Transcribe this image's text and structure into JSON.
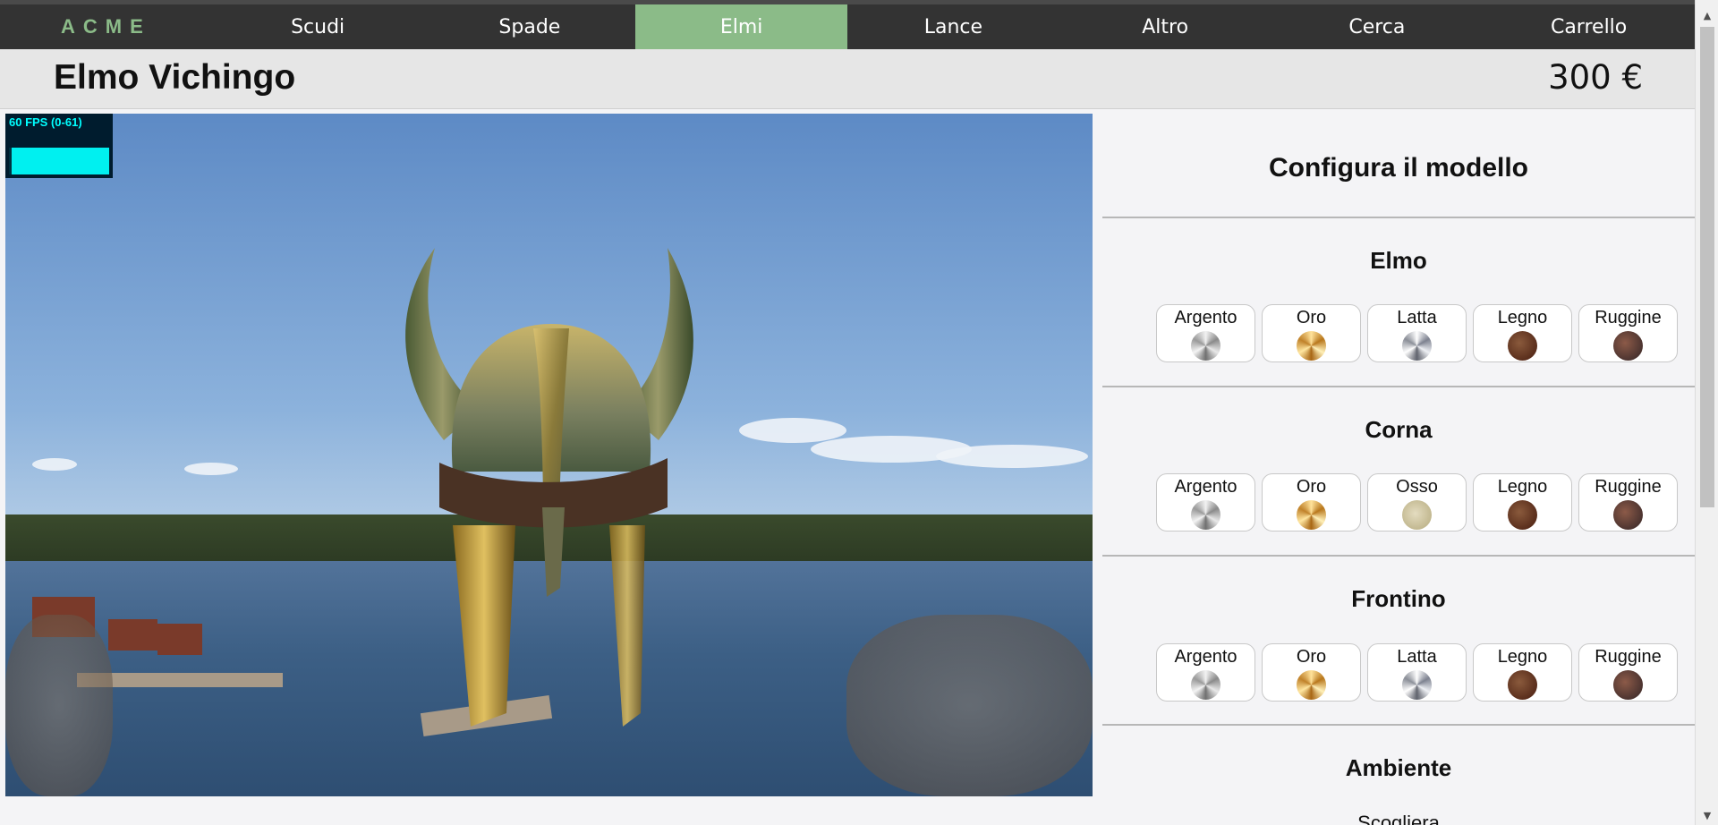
{
  "nav": {
    "logo": "ACME",
    "items": [
      {
        "label": "Scudi"
      },
      {
        "label": "Spade"
      },
      {
        "label": "Elmi"
      },
      {
        "label": "Lance"
      },
      {
        "label": "Altro"
      },
      {
        "label": "Cerca"
      },
      {
        "label": "Carrello"
      }
    ],
    "active": "Elmi"
  },
  "product": {
    "title": "Elmo Vichingo",
    "price": "300 €"
  },
  "fps": {
    "text": "60 FPS (0-61)"
  },
  "config": {
    "title": "Configura il modello",
    "sections": [
      {
        "title": "Elmo",
        "options": [
          {
            "label": "Argento",
            "swatch": "argento"
          },
          {
            "label": "Oro",
            "swatch": "oro"
          },
          {
            "label": "Latta",
            "swatch": "latta"
          },
          {
            "label": "Legno",
            "swatch": "legno"
          },
          {
            "label": "Ruggine",
            "swatch": "ruggine"
          }
        ]
      },
      {
        "title": "Corna",
        "options": [
          {
            "label": "Argento",
            "swatch": "argento"
          },
          {
            "label": "Oro",
            "swatch": "oro"
          },
          {
            "label": "Osso",
            "swatch": "osso"
          },
          {
            "label": "Legno",
            "swatch": "legno"
          },
          {
            "label": "Ruggine",
            "swatch": "ruggine"
          }
        ]
      },
      {
        "title": "Frontino",
        "options": [
          {
            "label": "Argento",
            "swatch": "argento"
          },
          {
            "label": "Oro",
            "swatch": "oro"
          },
          {
            "label": "Latta",
            "swatch": "latta"
          },
          {
            "label": "Legno",
            "swatch": "legno"
          },
          {
            "label": "Ruggine",
            "swatch": "ruggine"
          }
        ]
      },
      {
        "title": "Ambiente",
        "options": []
      }
    ],
    "ambiente_value": "Scogliera"
  },
  "colors": {
    "nav_bg": "#333333",
    "accent": "#8bbb88",
    "title_bar": "#e6e6e6",
    "fps_cyan": "#00ffff"
  },
  "icons": [
    "scroll-up-icon",
    "scroll-down-icon"
  ]
}
